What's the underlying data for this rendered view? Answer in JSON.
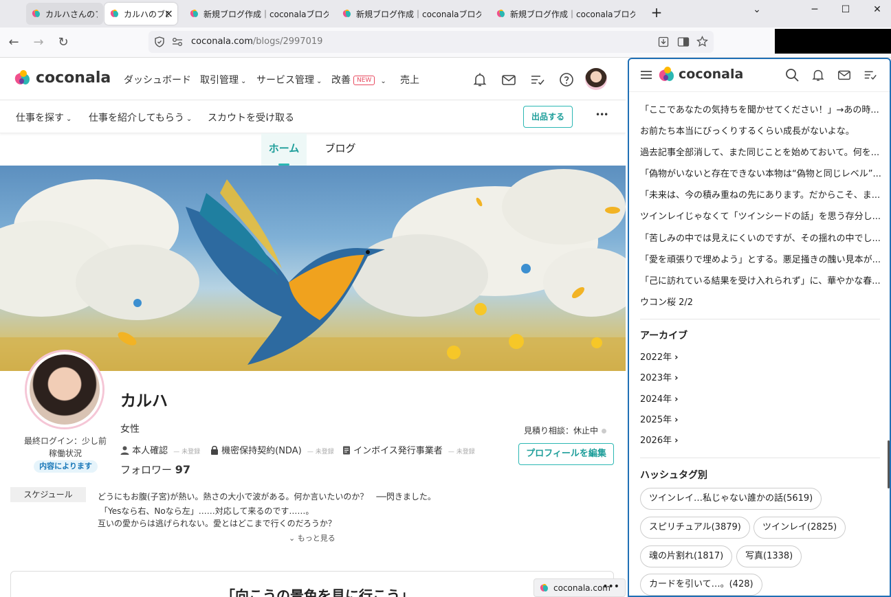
{
  "browser": {
    "tabs": [
      {
        "title": "カルハさんのブログ"
      },
      {
        "title": "カルハのブログ"
      },
      {
        "title": "新規ブログ作成｜coconalaブログ"
      },
      {
        "title": "新規ブログ作成｜coconalaブログ"
      },
      {
        "title": "新規ブログ作成｜coconalaブログ"
      }
    ],
    "new_tab": "+",
    "tab_close": "×",
    "url_domain": "coconala.com",
    "url_path": "/blogs/2997019",
    "window_controls": [
      "⌄",
      "─",
      "☐",
      "✕"
    ]
  },
  "header": {
    "logo": "coconala",
    "nav": {
      "dashboard": "ダッシュボード",
      "trades": "取引管理",
      "services": "サービス管理",
      "improve": "改善",
      "new_badge": "NEW",
      "sales": "売上"
    },
    "icons": [
      "bell-icon",
      "mail-icon",
      "checklist-icon",
      "help-icon"
    ]
  },
  "subnav": {
    "find_work": "仕事を探す",
    "introduce": "仕事を紹介してもらう",
    "scout": "スカウトを受け取る",
    "list_button": "出品する",
    "more": "•••"
  },
  "page_tabs": {
    "home": "ホーム",
    "blog": "ブログ"
  },
  "profile": {
    "last_login": "最終ログイン：少し前",
    "status_label": "稼働状況",
    "status_value": "内容によります",
    "name": "カルハ",
    "gender": "女性",
    "verifications": [
      {
        "label": "本人確認",
        "state": "未登録"
      },
      {
        "label": "機密保持契約(NDA)",
        "state": "未登録"
      },
      {
        "label": "インボイス発行事業者",
        "state": "未登録"
      }
    ],
    "followers_label": "フォロワー",
    "followers_count": "97",
    "estimate": "見積り相談：休止中",
    "edit_button": "プロフィールを編集",
    "schedule_label": "スケジュール",
    "intro_lines": [
      "どうにもお腹(子宮)が熱い。熱さの大小で波がある。何か言いたいのか？　──閃きました。",
      "「Yesなら右、Noなら左」……対応して来るのです……。",
      "互いの愛からは逃げられない。愛とはどこまで行くのだろうか？"
    ],
    "more_link": "もっと見る"
  },
  "featured_title": "「向こうの景色を見に行こう」",
  "status_popup": {
    "text": "coconala.com",
    "dots": "•••"
  },
  "sidebar": {
    "logo": "coconala",
    "recent_posts": [
      "「ここであなたの気持ちを聞かせてください！」→あの時...",
      "お前たち本当にびっくりするくらい成長がないよな。",
      "過去記事全部消して、また同じことを始めておいて。何を...",
      "「偽物がいないと存在できない本物は“偽物と同じレベル”...",
      "「未来は、今の積み重ねの先にあります。だからこそ、ま...",
      "ツインレイじゃなくて「ツインシードの話」を思う存分し...",
      "「苦しみの中では見えにくいのですが、その揺れの中でし...",
      "「愛を頑張りで埋めよう」とする。悪足掻きの醜い見本が...",
      "「己に訪れている結果を受け入れられず」に、華やかな春...",
      "ウコン桜 2/2"
    ],
    "archive_title": "アーカイブ",
    "archive_years": [
      "2022年",
      "2023年",
      "2024年",
      "2025年",
      "2026年"
    ],
    "hashtag_title": "ハッシュタグ別",
    "hashtags": [
      "ツインレイ…私じゃない誰かの話(5619)",
      "スピリチュアル(3879)",
      "ツインレイ(2825)",
      "魂の片割れ(1817)",
      "写真(1338)",
      "カードを引いて…。(428)"
    ]
  },
  "colors": {
    "accent": "#2bb7b3",
    "accent_dark": "#1e9e9a",
    "new_badge": "#e84a5f",
    "panel_border": "#1f6fb5"
  }
}
